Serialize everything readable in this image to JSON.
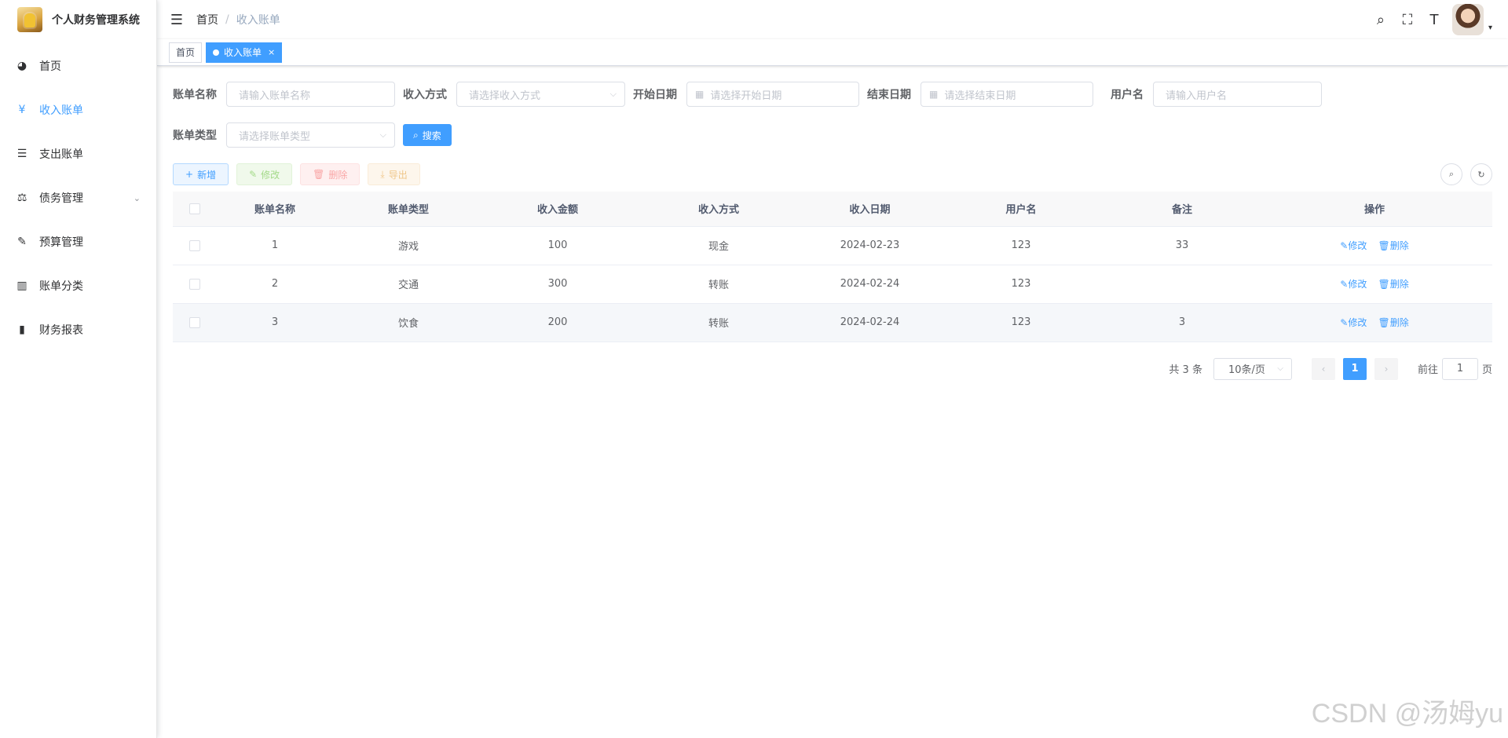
{
  "app": {
    "title": "个人财务管理系统"
  },
  "sidebar": {
    "items": [
      {
        "label": "首页",
        "icon": "dashboard-icon",
        "glyph": "◕"
      },
      {
        "label": "收入账单",
        "icon": "yen-icon",
        "glyph": "¥"
      },
      {
        "label": "支出账单",
        "icon": "list-icon",
        "glyph": "☰"
      },
      {
        "label": "债务管理",
        "icon": "debt-icon",
        "glyph": "⚖"
      },
      {
        "label": "预算管理",
        "icon": "edit-doc-icon",
        "glyph": "✎"
      },
      {
        "label": "账单分类",
        "icon": "book-icon",
        "glyph": "▥"
      },
      {
        "label": "财务报表",
        "icon": "bar-chart-icon",
        "glyph": "▮"
      }
    ],
    "arrow": "⌄"
  },
  "navbar": {
    "hamburger": "☰",
    "breadcrumb": {
      "home": "首页",
      "sep": "/",
      "current": "收入账单"
    },
    "icons": {
      "search": "⌕",
      "fullscreen": "⛶",
      "font_size": "T"
    },
    "caret": "▾"
  },
  "tags": {
    "home": "首页",
    "active": "收入账单",
    "close": "×"
  },
  "search_form": {
    "bill_name": {
      "label": "账单名称",
      "placeholder": "请输入账单名称"
    },
    "income_method": {
      "label": "收入方式",
      "placeholder": "请选择收入方式"
    },
    "start_date": {
      "label": "开始日期",
      "placeholder": "请选择开始日期"
    },
    "end_date": {
      "label": "结束日期",
      "placeholder": "请选择结束日期"
    },
    "username": {
      "label": "用户名",
      "placeholder": "请输入用户名"
    },
    "bill_type": {
      "label": "账单类型",
      "placeholder": "请选择账单类型"
    },
    "search_button": "搜索",
    "search_glyph": "⌕",
    "calendar_glyph": "▦",
    "select_arrow": "⌵"
  },
  "toolbar": {
    "add": "新增",
    "add_glyph": "+",
    "edit": "修改",
    "edit_glyph": "✎",
    "delete": "删除",
    "delete_glyph": "🗑",
    "export": "导出",
    "export_glyph": "⤓",
    "search_toggle": "⌕",
    "refresh": "↻"
  },
  "table": {
    "headers": [
      "账单名称",
      "账单类型",
      "收入金额",
      "收入方式",
      "收入日期",
      "用户名",
      "备注",
      "操作"
    ],
    "rows": [
      {
        "name": "1",
        "type": "游戏",
        "amount": "100",
        "method": "现金",
        "date": "2024-02-23",
        "user": "123",
        "note": "33"
      },
      {
        "name": "2",
        "type": "交通",
        "amount": "300",
        "method": "转账",
        "date": "2024-02-24",
        "user": "123",
        "note": ""
      },
      {
        "name": "3",
        "type": "饮食",
        "amount": "200",
        "method": "转账",
        "date": "2024-02-24",
        "user": "123",
        "note": "3"
      }
    ],
    "op_edit": "✎修改",
    "op_delete": "🗑删除"
  },
  "pagination": {
    "total": "共 3 条",
    "page_size": "10条/页",
    "size_arrow": "⌵",
    "prev": "‹",
    "current": "1",
    "next": "›",
    "goto_label": "前往",
    "goto_value": "1",
    "goto_suffix": "页"
  },
  "watermark": "CSDN @汤姆yu",
  "colors": {
    "primary": "#409eff"
  }
}
